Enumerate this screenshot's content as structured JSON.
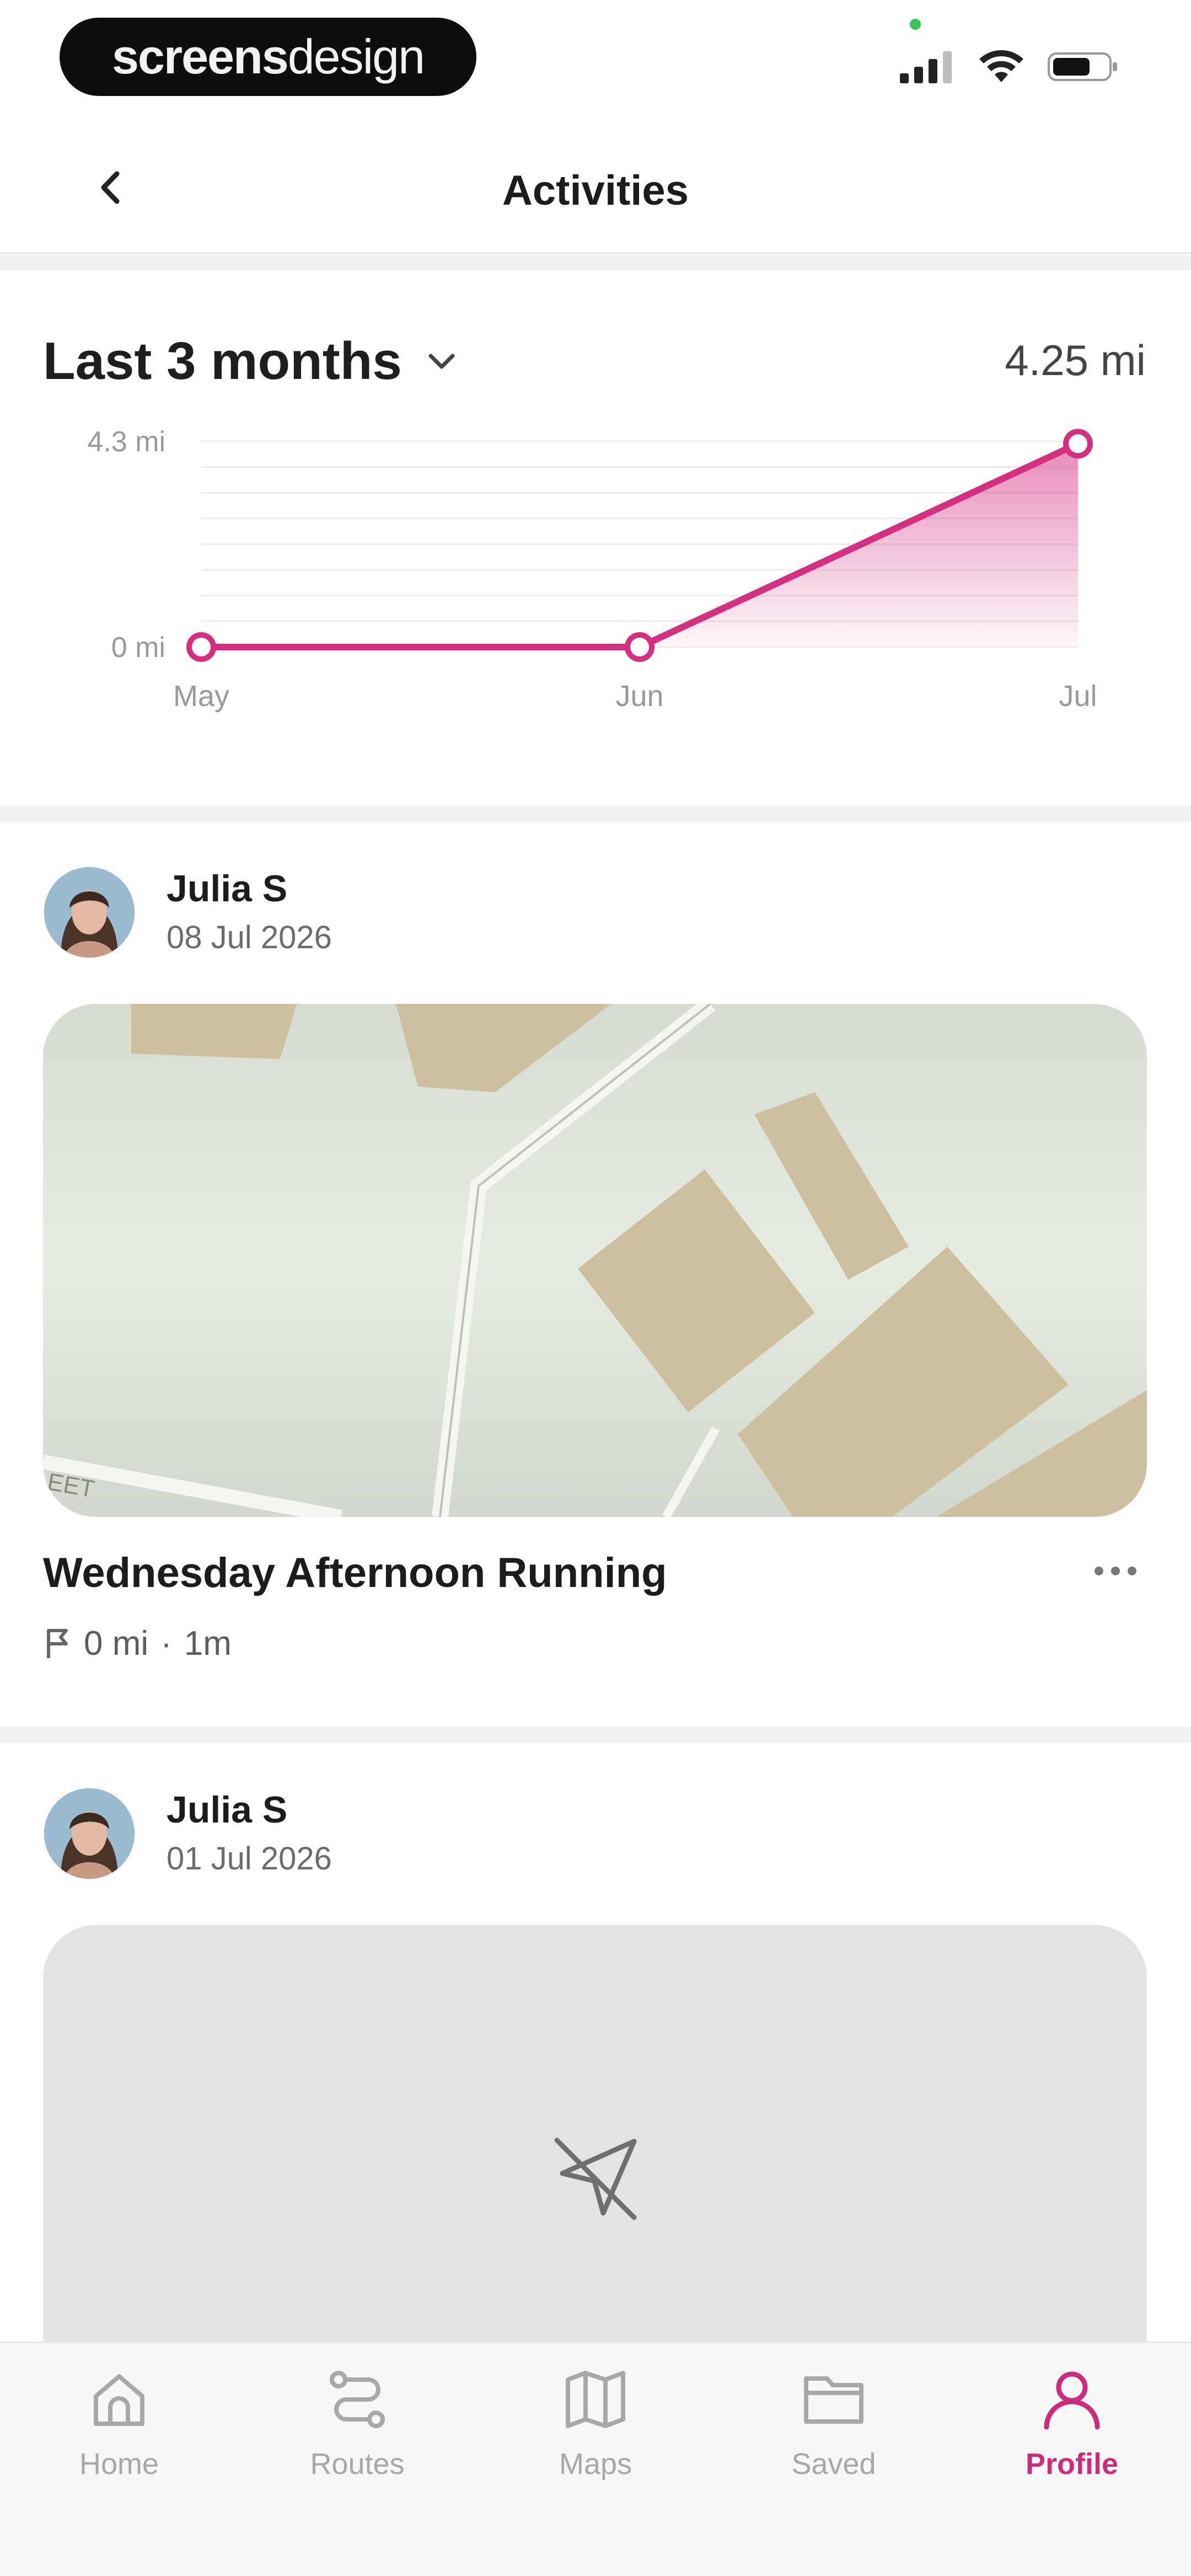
{
  "status_bar": {
    "brand_bold": "screens",
    "brand_light": "design",
    "icons": [
      "signal-icon",
      "wifi-icon",
      "battery-icon"
    ]
  },
  "header": {
    "title": "Activities",
    "back_icon": "chevron-left-icon"
  },
  "summary": {
    "range_label": "Last 3 months",
    "total": "4.25 mi"
  },
  "chart_data": {
    "type": "area",
    "categories": [
      "May",
      "Jun",
      "Jul"
    ],
    "series": [
      {
        "values": [
          0,
          0,
          4.25
        ]
      }
    ],
    "y_tick_labels": [
      "4.3 mi",
      "0 mi"
    ],
    "ylim": [
      0,
      4.3
    ],
    "grid": true,
    "accent_color": "#d42f80"
  },
  "activities": [
    {
      "user": "Julia S",
      "date": "08 Jul 2026",
      "title": "Wednesday Afternoon Running",
      "distance": "0 mi",
      "separator": "·",
      "duration": "1m",
      "has_map": true
    },
    {
      "user": "Julia S",
      "date": "01 Jul 2026",
      "has_map": false,
      "placeholder_icon": "location-off-icon"
    }
  ],
  "nav": {
    "items": [
      {
        "label": "Home",
        "icon": "home-icon",
        "active": false
      },
      {
        "label": "Routes",
        "icon": "routes-icon",
        "active": false
      },
      {
        "label": "Maps",
        "icon": "map-icon",
        "active": false
      },
      {
        "label": "Saved",
        "icon": "folder-icon",
        "active": false
      },
      {
        "label": "Profile",
        "icon": "profile-icon",
        "active": true
      }
    ],
    "active_color": "#cc2c7c",
    "inactive_color": "#a8a8a8"
  }
}
